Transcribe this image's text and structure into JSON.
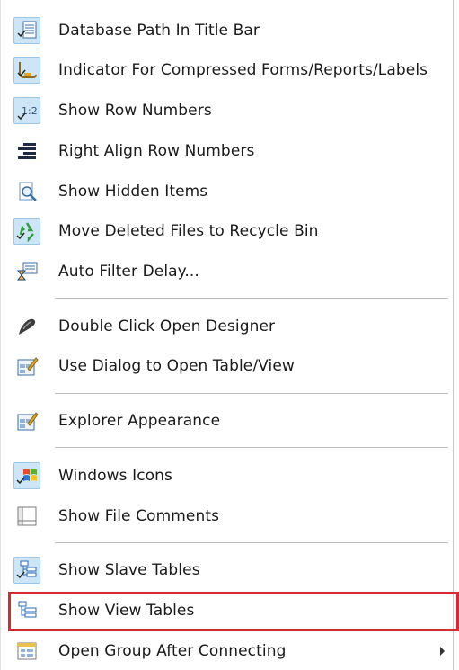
{
  "menu": {
    "items": [
      {
        "label": "Database Path In Title Bar",
        "icon": "database-path-icon",
        "checked": true
      },
      {
        "label": "Indicator For Compressed Forms/Reports/Labels",
        "icon": "compressed-indicator-icon",
        "checked": true
      },
      {
        "label": "Show Row Numbers",
        "icon": "row-numbers-icon",
        "checked": true
      },
      {
        "label": "Right Align Row Numbers",
        "icon": "right-align-icon",
        "checked": false
      },
      {
        "label": "Show Hidden Items",
        "icon": "hidden-items-icon",
        "checked": false
      },
      {
        "label": "Move Deleted Files to Recycle Bin",
        "icon": "recycle-bin-icon",
        "checked": true
      },
      {
        "label": "Auto Filter Delay...",
        "icon": "filter-delay-icon",
        "checked": false
      },
      {
        "label": "Double Click Open Designer",
        "icon": "designer-icon",
        "checked": false
      },
      {
        "label": "Use Dialog to Open Table/View",
        "icon": "dialog-open-icon",
        "checked": false
      },
      {
        "label": "Explorer Appearance",
        "icon": "explorer-appearance-icon",
        "checked": false
      },
      {
        "label": "Windows Icons",
        "icon": "windows-logo-icon",
        "checked": true
      },
      {
        "label": "Show File Comments",
        "icon": "file-comments-icon",
        "checked": false
      },
      {
        "label": "Show Slave Tables",
        "icon": "slave-tables-icon",
        "checked": true
      },
      {
        "label": "Show View Tables",
        "icon": "view-tables-icon",
        "checked": false
      },
      {
        "label": "Open Group After Connecting",
        "icon": "open-group-icon",
        "checked": false,
        "submenu": true
      }
    ]
  },
  "colors": {
    "highlight_border": "#d42a31",
    "checked_bg": "#cde6f7",
    "separator": "#bdbdbd"
  }
}
